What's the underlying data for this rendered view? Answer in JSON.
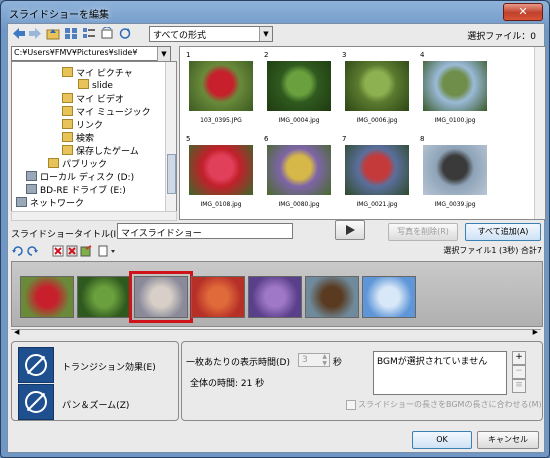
{
  "window": {
    "title": "スライドショーを編集",
    "close_label": "✕"
  },
  "toolbar": {
    "format_value": "すべての形式",
    "selected_files": "選択ファイル：0"
  },
  "folder": {
    "path": "C:¥Users¥FMV¥Pictures¥slide¥",
    "tree": [
      {
        "label": "マイ ピクチャ",
        "indent": 1
      },
      {
        "label": "slide",
        "indent": 2
      },
      {
        "label": "マイ ビデオ",
        "indent": 1
      },
      {
        "label": "マイ ミュージック",
        "indent": 1
      },
      {
        "label": "リンク",
        "indent": 1
      },
      {
        "label": "検索",
        "indent": 1
      },
      {
        "label": "保存したゲーム",
        "indent": 1
      },
      {
        "label": "パブリック",
        "indent": 0
      },
      {
        "label": "ローカル ディスク (D:)",
        "indent": -1
      },
      {
        "label": "BD-RE ドライブ (E:)",
        "indent": -1
      },
      {
        "label": "ネットワーク",
        "indent": -2
      }
    ]
  },
  "thumbnails": [
    {
      "num": "1",
      "caption": "103_0395.JPG",
      "colors": [
        "#6a8a3a",
        "#c81f2c",
        "#3b5a22"
      ]
    },
    {
      "num": "2",
      "caption": "IMG_0004.jpg",
      "colors": [
        "#2f5a1f",
        "#6aa03d",
        "#1f3a10"
      ]
    },
    {
      "num": "3",
      "caption": "IMG_0006.jpg",
      "colors": [
        "#5c7a2f",
        "#8db050",
        "#2b4515"
      ]
    },
    {
      "num": "4",
      "caption": "IMG_0100.jpg",
      "colors": [
        "#9bbad8",
        "#6f8e4a",
        "#3a5a2a"
      ]
    },
    {
      "num": "5",
      "caption": "IMG_0108.jpg",
      "colors": [
        "#c1202a",
        "#e0405a",
        "#3b6a2a"
      ]
    },
    {
      "num": "6",
      "caption": "IMG_0080.jpg",
      "colors": [
        "#7e65a8",
        "#d6b848",
        "#486a2a"
      ]
    },
    {
      "num": "7",
      "caption": "IMG_0021.jpg",
      "colors": [
        "#5a6f9c",
        "#c43a3a",
        "#2f4a2a"
      ]
    },
    {
      "num": "8",
      "caption": "IMG_0039.jpg",
      "colors": [
        "#8ea3b8",
        "#3a3a3a",
        "#b8c6d4"
      ]
    }
  ],
  "slideshow": {
    "title_label": "スライドショータイトル(I):",
    "title_value": "マイスライドショー",
    "remove_label": "写真を削除(R)",
    "add_all_label": "すべて追加(A)",
    "selected_info": "選択ファイル1 (3秒) 合計7",
    "film": [
      {
        "colors": [
          "#6a8a3a",
          "#c81f2c"
        ]
      },
      {
        "colors": [
          "#2f5a1f",
          "#6aa03d"
        ]
      },
      {
        "colors": [
          "#8a8a9a",
          "#d8d0c8"
        ],
        "selected": true
      },
      {
        "colors": [
          "#b73028",
          "#e06a3a"
        ]
      },
      {
        "colors": [
          "#5a3f8a",
          "#9f78c8"
        ]
      },
      {
        "colors": [
          "#6f8a9a",
          "#5a3a20"
        ]
      },
      {
        "colors": [
          "#5f96d8",
          "#d8e8f8"
        ]
      }
    ]
  },
  "effects": {
    "transition_label": "トランジション効果(E)",
    "panzoom_label": "パン＆ズーム(Z)"
  },
  "timing": {
    "per_slide_label": "一枚あたりの表示時間(D)",
    "per_slide_value": "3",
    "sec_unit": "秒",
    "total_label": "全体の時間: 21 秒",
    "bgm_text": "BGMが選択されていません",
    "fit_label": "スライドショーの長さをBGMの長さに合わせる(M)"
  },
  "footer": {
    "ok_label": "OK",
    "cancel_label": "キャンセル"
  }
}
